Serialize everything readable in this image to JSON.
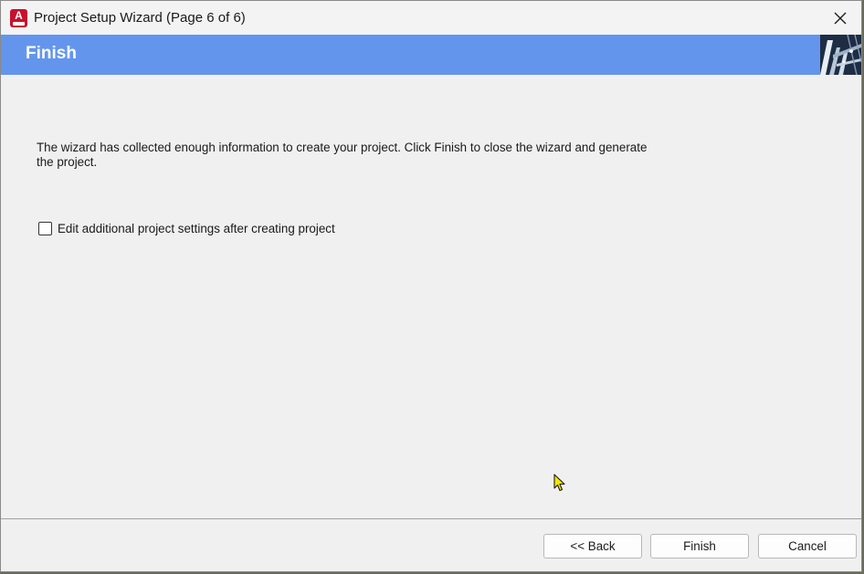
{
  "window": {
    "title": "Project Setup Wizard (Page 6 of 6)",
    "app_icon_letter": "A",
    "close_icon": "close-icon"
  },
  "banner": {
    "title": "Finish",
    "color": "#6495ed"
  },
  "content": {
    "message": "The wizard has collected enough information to create your project. Click Finish to close the wizard and generate the project.",
    "checkbox_label": "Edit additional project settings after creating project",
    "checkbox_checked": false
  },
  "footer": {
    "back_label": "<< Back",
    "finish_label": "Finish",
    "cancel_label": "Cancel"
  }
}
